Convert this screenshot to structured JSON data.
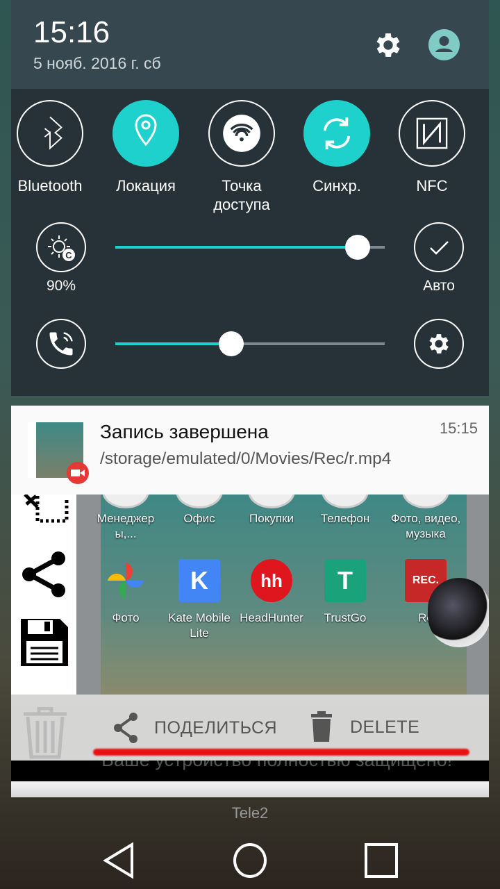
{
  "header": {
    "time": "15:16",
    "date": "5 нояб. 2016 г. сб",
    "icons": [
      "gear-icon",
      "account-icon"
    ]
  },
  "toggles": [
    {
      "label": "Bluetooth",
      "icon": "bluetooth-icon",
      "active": false
    },
    {
      "label": "Локация",
      "icon": "location-icon",
      "active": true
    },
    {
      "label": "Точка\nдоступа",
      "line1": "Точка",
      "line2": "доступа",
      "icon": "wifi-hotspot-icon",
      "active": false
    },
    {
      "label": "Синхр.",
      "icon": "sync-icon",
      "active": true
    },
    {
      "label": "NFC",
      "icon": "nfc-icon",
      "active": false
    }
  ],
  "brightness": {
    "value_label": "90%",
    "level_percent": 90,
    "auto_label": "Авто",
    "auto": true
  },
  "volume": {
    "level_percent": 43
  },
  "colors": {
    "accent": "#1fd1cc",
    "panel": "#263238",
    "header": "#37474f",
    "red_line": "#e81010"
  },
  "notification": {
    "title": "Запись завершена",
    "path": "/storage/emulated/0/Movies/Rec/r.mp4",
    "time": "15:15",
    "actions": [
      {
        "label": "ПОДЕЛИТЬСЯ",
        "icon": "share-icon"
      },
      {
        "label": "DELETE",
        "icon": "trash-icon"
      }
    ]
  },
  "preview": {
    "row1": [
      "Менеджер\nы,...",
      "Офис",
      "Покупки",
      "Телефон",
      "Фото, видео,\nмузыка"
    ],
    "row2": [
      "Фото",
      "Kate Mobile\nLite",
      "HeadHunter",
      "TrustGo",
      "Re"
    ],
    "hidden_text": "Ваше устройство полностью защищено!"
  },
  "dock": {
    "label": "Tele2"
  },
  "navbar": {
    "buttons": [
      "back",
      "home",
      "recents"
    ]
  }
}
